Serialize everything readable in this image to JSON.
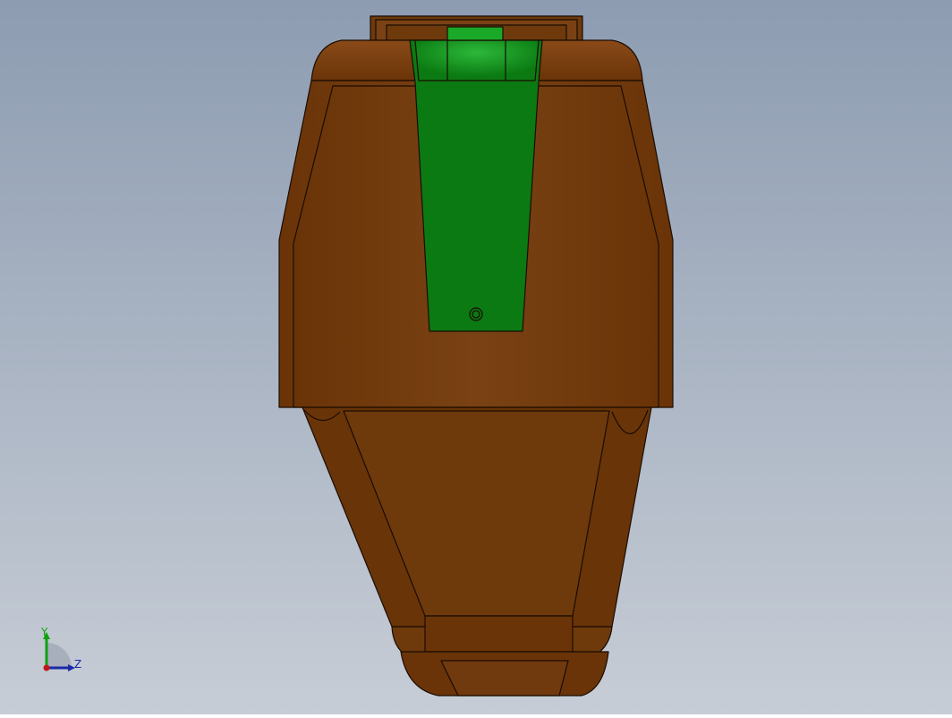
{
  "scene": {
    "background_top": "#8d9cb1",
    "background_bottom": "#c7cdd6",
    "body_color": "#6b3509",
    "body_highlight": "#7d4514",
    "cap_color": "#0b7a12",
    "cap_highlight": "#2cb83a"
  },
  "triad": {
    "y_label": "Y",
    "z_label": "Z",
    "y_color": "#10a010",
    "z_color": "#1a2aa8",
    "origin_color": "#c01818"
  }
}
